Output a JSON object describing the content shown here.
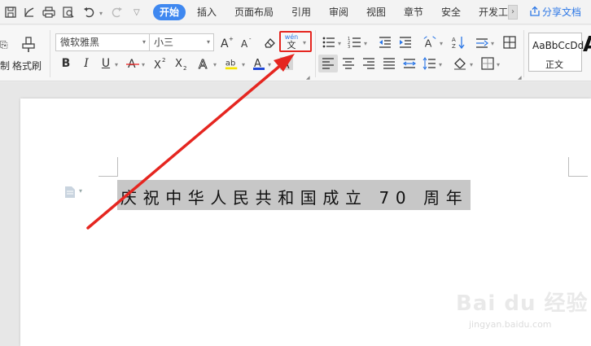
{
  "menubar": {
    "items": [
      "开始",
      "插入",
      "页面布局",
      "引用",
      "审阅",
      "视图",
      "章节",
      "安全",
      "开发工"
    ],
    "active_index": 0,
    "share_label": "分享文档",
    "accent": "#3f88f0"
  },
  "ribbon": {
    "font_name": "微软雅黑",
    "font_size": "小三",
    "left_partial_label": "制",
    "format_painter_label": "格式刷",
    "style_sample": "AaBbCcDd",
    "style_name": "正文",
    "big_a": "A",
    "phonetic_top": "wén",
    "phonetic_bottom": "文",
    "highlight_color": "#e52620"
  },
  "document": {
    "selected_text": "庆祝中华人民共和国成立 70 周年",
    "selection_color": "#c7c7c7"
  },
  "watermark": {
    "brand": "Bai du 经验",
    "url": "jingyan.baidu.com"
  }
}
